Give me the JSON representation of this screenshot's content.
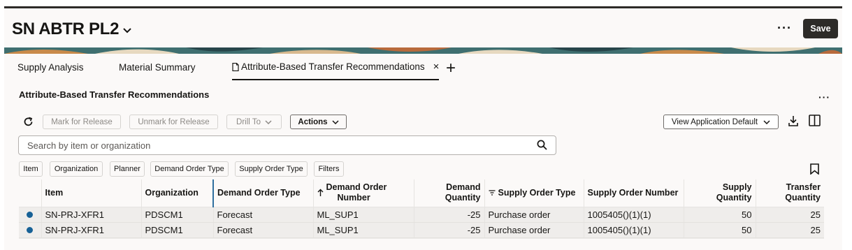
{
  "header": {
    "title": "SN ABTR PL2",
    "more_label": "···",
    "save_label": "Save"
  },
  "tabs": [
    {
      "label": "Supply Analysis"
    },
    {
      "label": "Material Summary"
    },
    {
      "label": "Attribute-Based Transfer Recommendations",
      "active": true,
      "close": "×"
    }
  ],
  "add_tab": "+",
  "section": {
    "title": "Attribute-Based Transfer Recommendations",
    "more_label": "···"
  },
  "toolbar": {
    "mark_release": "Mark for Release",
    "unmark_release": "Unmark for Release",
    "drill_to": "Drill To",
    "actions": "Actions",
    "view": "View Application Default"
  },
  "search": {
    "placeholder": "Search by item or organization",
    "value": ""
  },
  "chips": [
    "Item",
    "Organization",
    "Planner",
    "Demand Order Type",
    "Supply Order Type",
    "Filters"
  ],
  "table": {
    "headers": {
      "item": "Item",
      "organization": "Organization",
      "demand_order_type": "Demand Order Type",
      "demand_order_number_1": "Demand Order",
      "demand_order_number_2": "Number",
      "demand_quantity_1": "Demand",
      "demand_quantity_2": "Quantity",
      "supply_order_type": "Supply Order Type",
      "supply_order_number": "Supply Order Number",
      "supply_quantity_1": "Supply",
      "supply_quantity_2": "Quantity",
      "transfer_quantity_1": "Transfer",
      "transfer_quantity_2": "Quantity"
    },
    "rows": [
      {
        "item": "SN-PRJ-XFR1",
        "organization": "PDSCM1",
        "demand_order_type": "Forecast",
        "demand_order_number": "ML_SUP1",
        "demand_quantity": "-25",
        "supply_order_type": "Purchase order",
        "supply_order_number": "1005405()(1)(1)",
        "supply_quantity": "50",
        "transfer_quantity": "25"
      },
      {
        "item": "SN-PRJ-XFR1",
        "organization": "PDSCM1",
        "demand_order_type": "Forecast",
        "demand_order_number": "ML_SUP1",
        "demand_quantity": "-25",
        "supply_order_type": "Purchase order",
        "supply_order_number": "1005405()(1)(1)",
        "supply_quantity": "50",
        "transfer_quantity": "25"
      }
    ]
  },
  "colors": {
    "accent_dark": "#2d2b28",
    "status_dot": "#176196",
    "sort_separator": "#2f6f9f"
  }
}
